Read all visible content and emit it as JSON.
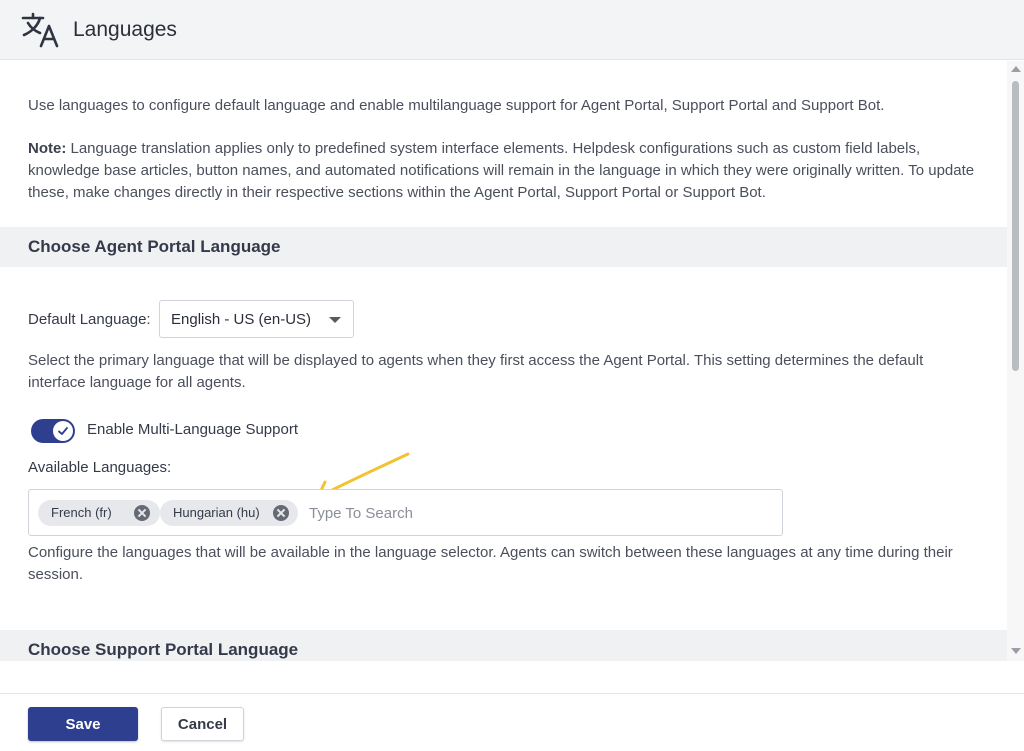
{
  "header": {
    "title": "Languages",
    "icon": "translate-icon"
  },
  "intro": {
    "text": "Use languages to configure default language and enable multilanguage support for Agent Portal, Support Portal and Support Bot.",
    "note_label": "Note:",
    "note_text": " Language translation applies only to predefined system interface elements. Helpdesk configurations such as custom field labels, knowledge base articles, button names, and automated notifications will remain in the language in which they were originally written. To update these, make changes directly in their respective sections within the Agent Portal, Support Portal or Support Bot."
  },
  "agent_portal": {
    "section_title": "Choose Agent Portal Language",
    "default_language_label": "Default Language:",
    "default_language_value": "English - US (en-US)",
    "default_language_help": "Select the primary language that will be displayed to agents when they first access the Agent Portal. This setting determines the default interface language for all agents.",
    "multi_language_label": "Enable Multi-Language Support",
    "multi_language_enabled": true,
    "available_label": "Available Languages:",
    "available_languages": [
      "French (fr)",
      "Hungarian (hu)"
    ],
    "search_placeholder": "Type To Search",
    "available_help": "Configure the languages that will be available in the language selector. Agents can switch between these languages at any time during their session."
  },
  "support_portal": {
    "section_title": "Choose Support Portal Language"
  },
  "footer": {
    "save_label": "Save",
    "cancel_label": "Cancel"
  },
  "colors": {
    "primary": "#2f3f8f",
    "annotation_arrow": "#f2c230"
  }
}
